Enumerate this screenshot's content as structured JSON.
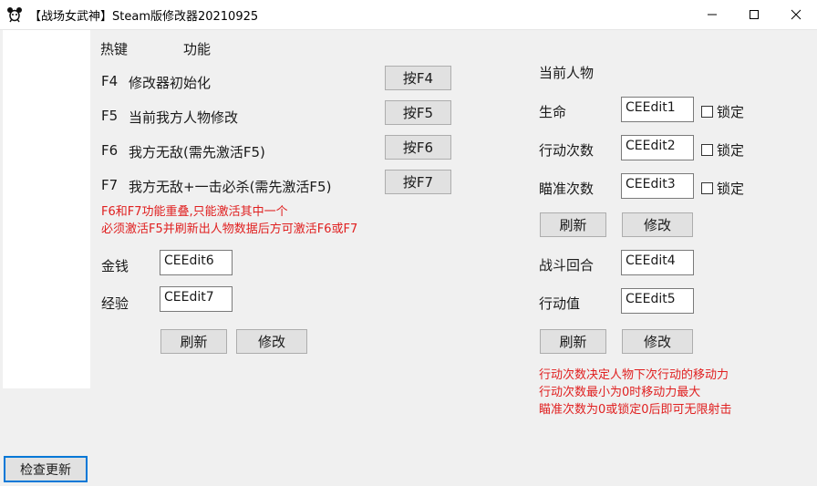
{
  "window": {
    "title": "【战场女武神】Steam版修改器20210925"
  },
  "sidebar": {
    "update_button": "检查更新"
  },
  "left": {
    "header_hotkey": "热键",
    "header_function": "功能",
    "hotkeys": [
      {
        "key": "F4",
        "desc": "修改器初始化",
        "button": "按F4"
      },
      {
        "key": "F5",
        "desc": "当前我方人物修改",
        "button": "按F5"
      },
      {
        "key": "F6",
        "desc": "我方无敌(需先激活F5)",
        "button": "按F6"
      },
      {
        "key": "F7",
        "desc": "我方无敌+一击必杀(需先激活F5)",
        "button": "按F7"
      }
    ],
    "warning_lines": [
      "F6和F7功能重叠,只能激活其中一个",
      "必须激活F5并刷新出人物数据后方可激活F6或F7"
    ],
    "money_label": "金钱",
    "money_value": "CEEdit6",
    "exp_label": "经验",
    "exp_value": "CEEdit7",
    "refresh": "刷新",
    "modify": "修改"
  },
  "right": {
    "section_title": "当前人物",
    "fields": [
      {
        "label": "生命",
        "value": "CEEdit1",
        "lock": "锁定"
      },
      {
        "label": "行动次数",
        "value": "CEEdit2",
        "lock": "锁定"
      },
      {
        "label": "瞄准次数",
        "value": "CEEdit3",
        "lock": "锁定"
      }
    ],
    "refresh1": "刷新",
    "modify1": "修改",
    "battle_round_label": "战斗回合",
    "battle_round_value": "CEEdit4",
    "action_value_label": "行动值",
    "action_value_value": "CEEdit5",
    "refresh2": "刷新",
    "modify2": "修改",
    "notes": [
      "行动次数决定人物下次行动的移动力",
      "行动次数最小为0时移动力最大",
      "瞄准次数为0或锁定0后即可无限射击"
    ]
  },
  "colors": {
    "warning": "#e02020",
    "focus_border": "#0078d7"
  }
}
